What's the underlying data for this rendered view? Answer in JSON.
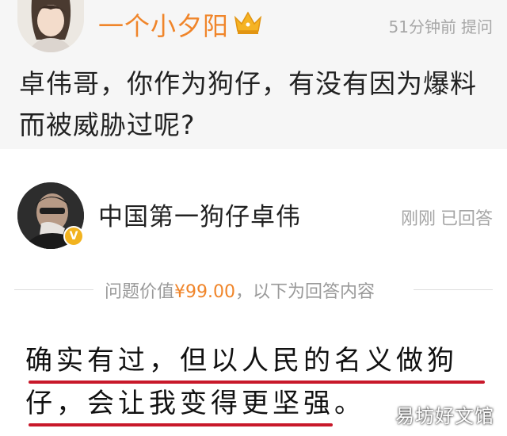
{
  "question": {
    "asker_name": "一个小夕阳",
    "time": "51分钟前",
    "action": "提问",
    "text": "卓伟哥，你作为狗仔，有没有因为爆料而被威胁过呢?"
  },
  "answer": {
    "answerer_name": "中国第一狗仔卓伟",
    "time": "刚刚",
    "status": "已回答",
    "price_prefix": "问题价值",
    "price_value": "¥99.00",
    "price_suffix": "，以下为回答内容",
    "line1": "确实有过，但以人民的名义做狗",
    "line2": "仔，会让我变得更坚强。"
  },
  "watermark": "易坊好文馆",
  "colors": {
    "name_orange": "#f0852a",
    "underline_red": "#c8182a",
    "verify_badge": "#f2b31f"
  },
  "icons": {
    "crown": "crown-icon",
    "verified": "verified-v-icon"
  }
}
